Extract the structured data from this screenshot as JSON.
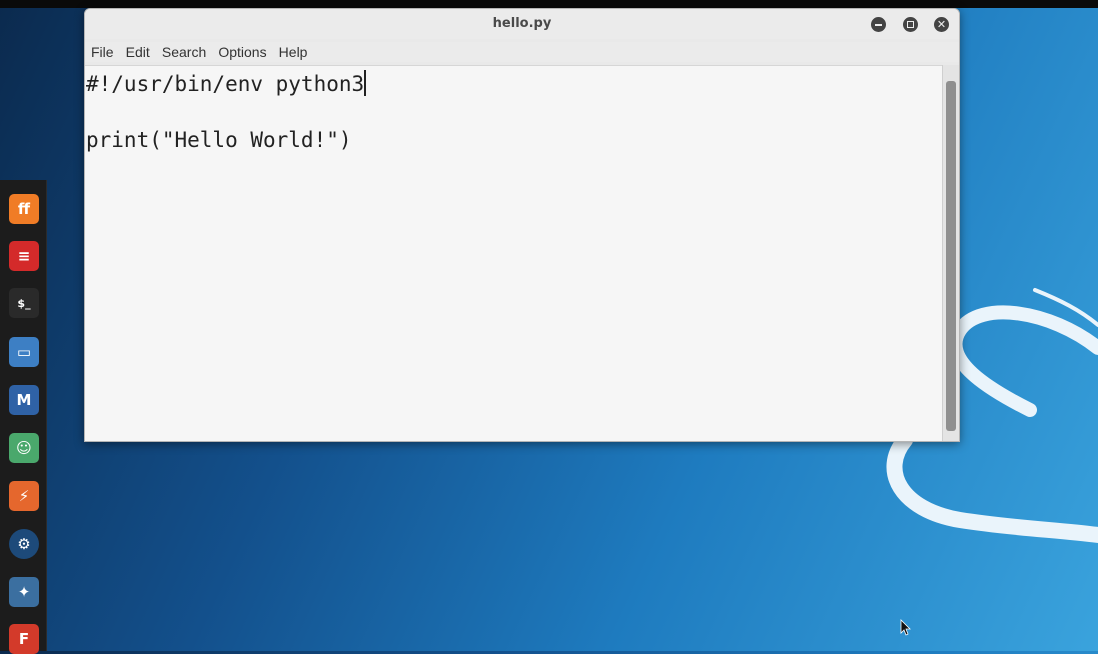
{
  "window": {
    "title": "hello.py"
  },
  "menu": [
    "File",
    "Edit",
    "Search",
    "Options",
    "Help"
  ],
  "editor": {
    "lines": [
      "#!/usr/bin/env python3",
      "",
      "print(\"Hello World!\")"
    ]
  },
  "dock": [
    {
      "name": "firefox-icon",
      "color": "#f07c26"
    },
    {
      "name": "kali-tools-icon",
      "color": "#d42a2a"
    },
    {
      "name": "terminal-icon",
      "color": "#2a2a2a"
    },
    {
      "name": "files-icon",
      "color": "#3d7fc4"
    },
    {
      "name": "metasploit-icon",
      "color": "#2f62a6"
    },
    {
      "name": "armitage-icon",
      "color": "#4aa86c"
    },
    {
      "name": "burpsuite-icon",
      "color": "#e5672d"
    },
    {
      "name": "maltego-icon",
      "color": "#1d4a7a"
    },
    {
      "name": "beef-icon",
      "color": "#3b6fa0"
    },
    {
      "name": "faraday-icon",
      "color": "#d33a2a"
    }
  ]
}
